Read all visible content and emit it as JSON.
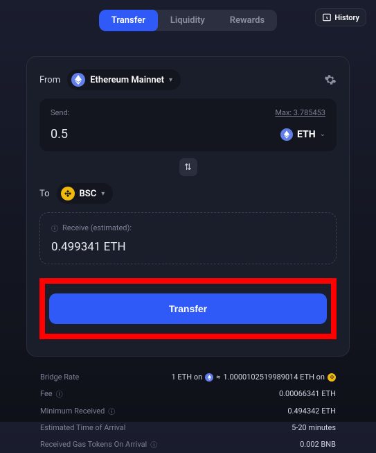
{
  "tabs": {
    "transfer": "Transfer",
    "liquidity": "Liquidity",
    "rewards": "Rewards"
  },
  "history": "History",
  "from": {
    "label": "From",
    "chain": "Ethereum Mainnet",
    "send_label": "Send:",
    "max_label": "Max: 3.785453",
    "amount": "0.5",
    "token": "ETH"
  },
  "to": {
    "label": "To",
    "chain": "BSC",
    "receive_label": "Receive (estimated):",
    "amount": "0.499341 ETH"
  },
  "transfer_button": "Transfer",
  "details": {
    "bridge_rate_label": "Bridge Rate",
    "bridge_rate_left": "1 ETH on",
    "bridge_rate_mid": "≈",
    "bridge_rate_right": "1.0000102519989014 ETH on",
    "fee_label": "Fee",
    "fee_value": "0.00066341 ETH",
    "min_label": "Minimum Received",
    "min_value": "0.494342 ETH",
    "eta_label": "Estimated Time of Arrival",
    "eta_value": "5-20 minutes",
    "gas_label": "Received Gas Tokens On Arrival",
    "gas_value": "0.002 BNB"
  }
}
